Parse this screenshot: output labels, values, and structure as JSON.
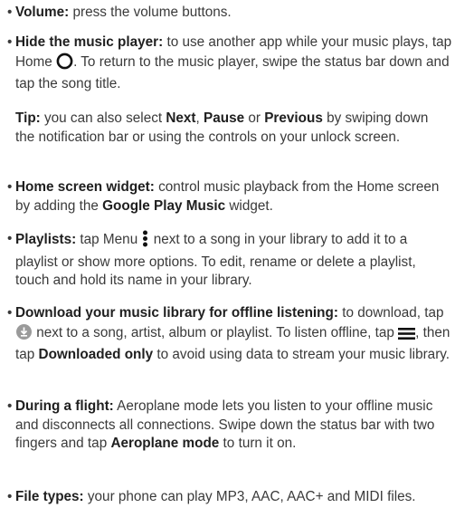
{
  "items": [
    {
      "title": "Volume:",
      "text": " press the volume buttons."
    },
    {
      "title": "Hide the music player:",
      "text_a": " to use another app while your music plays, tap Home ",
      "icon": "home-circle-icon",
      "text_b": ". To return to the music player, swipe the status bar down and tap the song title."
    },
    {
      "tip_label": "Tip:",
      "t1": " you can also select ",
      "b1": "Next",
      "t2": ", ",
      "b2": "Pause",
      "t3": " or ",
      "b3": "Previous",
      "t4": " by swiping down the notification bar or using the controls on your unlock screen."
    },
    {
      "title": "Home screen widget:",
      "text_a": " control music playback from the Home screen by adding the ",
      "bold": "Google Play Music",
      "text_b": " widget."
    },
    {
      "title": "Playlists:",
      "text_a": " tap Menu ",
      "icon": "menu-vertical-dots-icon",
      "text_b": " next to a song in your library to add it to a playlist or show more options. To edit, rename or delete a playlist, touch and hold its name in your library."
    },
    {
      "title": "Download your music library for offline listening:",
      "text_a": " to download, tap ",
      "icon1": "download-icon",
      "text_b": " next to a song, artist, album or playlist. To listen offline, tap ",
      "icon2": "hamburger-menu-icon",
      "text_c": ", then tap ",
      "bold": "Downloaded only",
      "text_d": " to avoid using data to stream your music library."
    },
    {
      "title": "During a flight:",
      "text_a": " Aeroplane mode lets you listen to your offline music and disconnects all connections. Swipe down the status bar with two fingers and tap ",
      "bold": "Aeroplane mode",
      "text_b": " to turn it on."
    },
    {
      "title": "File types:",
      "text": " your phone can play MP3, AAC, AAC+ and MIDI files."
    }
  ],
  "bullet": "•"
}
